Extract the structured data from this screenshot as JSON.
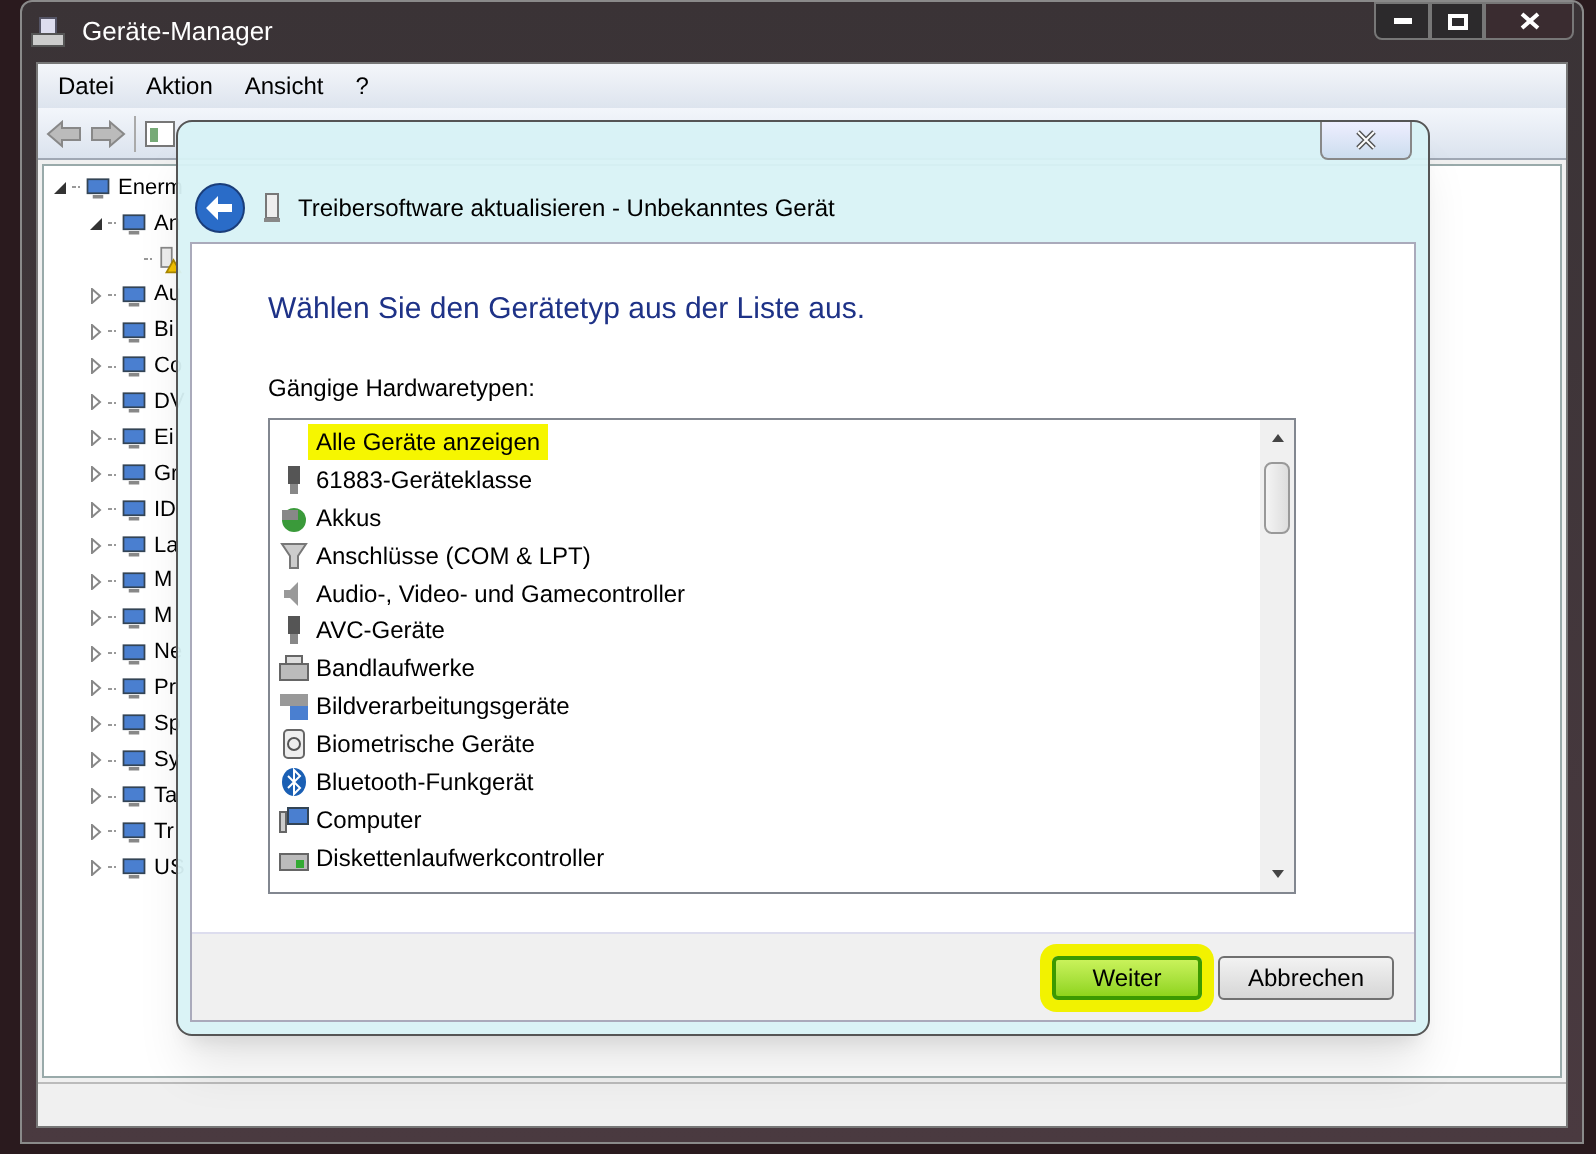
{
  "window": {
    "title": "Geräte-Manager"
  },
  "menu": [
    "Datei",
    "Aktion",
    "Ansicht",
    "?"
  ],
  "tree": [
    {
      "label": "Enerm",
      "expanded": true,
      "children": [
        {
          "label": "An",
          "expanded": true,
          "children": [
            {
              "warning": true
            }
          ]
        },
        {
          "label": "Au",
          "expanded": false
        },
        {
          "label": "Bi",
          "expanded": false
        },
        {
          "label": "Co",
          "expanded": false
        },
        {
          "label": "DV",
          "expanded": false
        },
        {
          "label": "Ei",
          "expanded": false
        },
        {
          "label": "Gr",
          "expanded": false
        },
        {
          "label": "ID",
          "expanded": false
        },
        {
          "label": "La",
          "expanded": false
        },
        {
          "label": "M",
          "expanded": false
        },
        {
          "label": "M",
          "expanded": false
        },
        {
          "label": "Ne",
          "expanded": false
        },
        {
          "label": "Pr",
          "expanded": false
        },
        {
          "label": "Sp",
          "expanded": false
        },
        {
          "label": "Sy",
          "expanded": false
        },
        {
          "label": "Ta",
          "expanded": false
        },
        {
          "label": "Tr",
          "expanded": false
        },
        {
          "label": "US",
          "expanded": false
        }
      ]
    }
  ],
  "dialog": {
    "title": "Treibersoftware aktualisieren - Unbekanntes Gerät",
    "heading": "Wählen Sie den Gerätetyp aus der Liste aus.",
    "list_label": "Gängige Hardwaretypen:",
    "items": [
      {
        "label": "Alle Geräte anzeigen",
        "selected": true
      },
      {
        "label": "61883-Geräteklasse",
        "selected": false
      },
      {
        "label": "Akkus",
        "selected": false
      },
      {
        "label": "Anschlüsse (COM & LPT)",
        "selected": false
      },
      {
        "label": "Audio-, Video- und Gamecontroller",
        "selected": false
      },
      {
        "label": "AVC-Geräte",
        "selected": false
      },
      {
        "label": "Bandlaufwerke",
        "selected": false
      },
      {
        "label": "Bildverarbeitungsgeräte",
        "selected": false
      },
      {
        "label": "Biometrische Geräte",
        "selected": false
      },
      {
        "label": "Bluetooth-Funkgerät",
        "selected": false
      },
      {
        "label": "Computer",
        "selected": false
      },
      {
        "label": "Diskettenlaufwerkcontroller",
        "selected": false
      }
    ],
    "buttons": [
      {
        "label": "Weiter",
        "default": true
      },
      {
        "label": "Abbrechen",
        "default": false
      }
    ]
  }
}
